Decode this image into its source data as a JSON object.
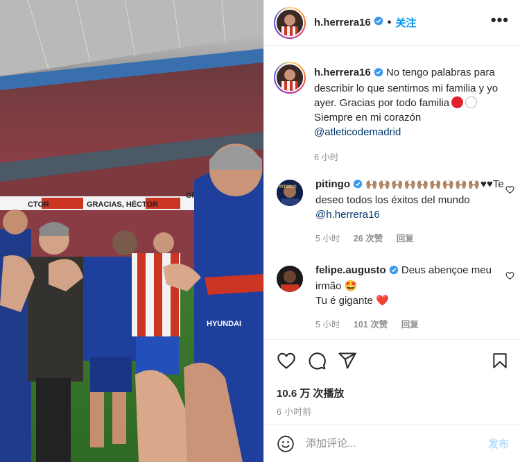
{
  "header": {
    "username": "h.herrera16",
    "separator": "•",
    "follow_label": "关注",
    "more_label": "•••"
  },
  "video": {
    "banner_left": "CTOR",
    "banner_center": "GRACIAS, HÉCTOR",
    "banner_right": "GRACIAS",
    "sponsor_text": "HYUNDAI"
  },
  "caption": {
    "username": "h.herrera16",
    "text_line1": "No tengo palabras para describir lo que sentimos mi familia y yo ayer. Gracias por todo familia",
    "text_line2": "Siempre en mi corazón",
    "mention": "@atleticodemadrid",
    "time": "6 小时"
  },
  "comments": [
    {
      "username": "pitingo",
      "emoji": "🙌🏽🙌🏽🙌🏽🙌🏽🙌🏽🙌🏽🙌🏽🙌🏽🙌🏽",
      "text": "♥♥Te deseo todos los éxitos del mundo",
      "mention": "@h.herrera16",
      "time": "5 小时",
      "likes": "26 次赞",
      "reply": "回复"
    },
    {
      "username": "felipe.augusto",
      "text": "Deus abençoe meu irmão",
      "emoji": "🤩",
      "text2": "Tu é gigante",
      "emoji2": "❤️",
      "time": "5 小时",
      "likes": "101 次赞",
      "reply": "回复"
    }
  ],
  "stats": {
    "views": "10.6 万 次播放",
    "time": "6 小时前"
  },
  "comment_box": {
    "placeholder": "添加评论...",
    "post_label": "发布"
  },
  "colors": {
    "link": "#00376b",
    "follow": "#0095f6",
    "verified": "#3897f0",
    "muted": "#8e8e8e",
    "atletico_red": "#cb3524"
  }
}
